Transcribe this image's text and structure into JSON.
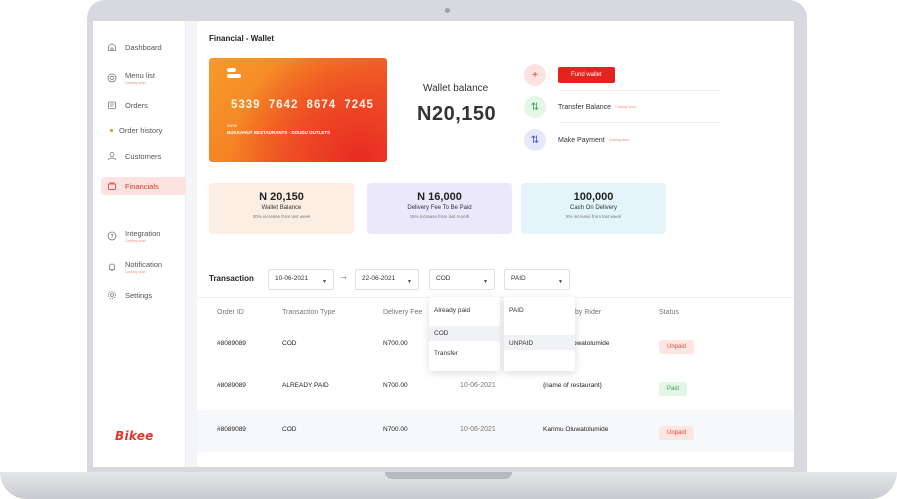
{
  "sidebar": {
    "items": [
      {
        "label": "Dashboard",
        "icon": "home-icon"
      },
      {
        "label": "Menu list",
        "sub": "Coming soon",
        "icon": "menu-list-icon"
      },
      {
        "label": "Orders",
        "icon": "orders-icon"
      },
      {
        "label": "Order history",
        "icon": "bullet"
      },
      {
        "label": "Customers",
        "icon": "customers-icon"
      },
      {
        "label": "Financials",
        "icon": "financials-icon",
        "active": true
      },
      {
        "label": "Integration",
        "sub": "Coming soon",
        "icon": "integration-icon"
      },
      {
        "label": "Notification",
        "sub": "Coming soon",
        "icon": "bell-icon"
      },
      {
        "label": "Settings",
        "icon": "gear-icon"
      }
    ],
    "logo": "Bikee"
  },
  "page": {
    "title": "Financial - Wallet"
  },
  "card": {
    "number": "5339 7642 8674 7245",
    "expiry": "03/30",
    "holder": "BUKKAHUT RESTAURANTS - DOUDU OUTLETS"
  },
  "wallet": {
    "label": "Wallet balance",
    "amount": "N20,150"
  },
  "actions": {
    "fund": {
      "label": "Fund wallet",
      "icon": "plus-icon"
    },
    "transfer": {
      "label": "Transfer Balance",
      "soon": "Coming soon",
      "icon": "transfer-icon"
    },
    "payment": {
      "label": "Make Payment",
      "soon": "Coming soon",
      "icon": "payment-icon"
    }
  },
  "stats": [
    {
      "value": "N 20,150",
      "label": "Wallet Balance",
      "note": "20% increase from last week",
      "color": "#fdeee3"
    },
    {
      "value": "N 16,000",
      "label": "Delivery Fee To Be Paid",
      "note": "15% increase from last month",
      "color": "#ebe8fb"
    },
    {
      "value": "100,000",
      "label": "Cash On Delivery",
      "note": "5% increase from last week",
      "color": "#e3f4fb"
    }
  ],
  "transactions": {
    "title": "Transaction",
    "filters": {
      "from": "10-06-2021",
      "to": "22-06-2021",
      "type": "COD",
      "status": "PAID"
    },
    "type_options": [
      "Already paid",
      "COD",
      "Transfer"
    ],
    "status_options": [
      "PAID",
      "UNPAID"
    ],
    "columns": [
      "Order ID",
      "Transaction Type",
      "Delivery Fee",
      "by Rider",
      "Status"
    ],
    "rows": [
      {
        "id": "#8089089",
        "type": "COD",
        "fee": "N700.00",
        "date": "",
        "rider": "owatolumide",
        "status": "Unpaid"
      },
      {
        "id": "#8089089",
        "type": "ALREADY PAID",
        "fee": "N700.00",
        "date": "10-06-2021",
        "rider": "{name of restaurant}",
        "status": "Paid"
      },
      {
        "id": "#8089089",
        "type": "COD",
        "fee": "N700.00",
        "date": "10-06-2021",
        "rider": "Karimu Oluwatolumide",
        "status": "Unpaid"
      }
    ]
  },
  "colors": {
    "accent": "#e4231e",
    "paid": "#3aa55a",
    "unpaid": "#e4473a"
  }
}
